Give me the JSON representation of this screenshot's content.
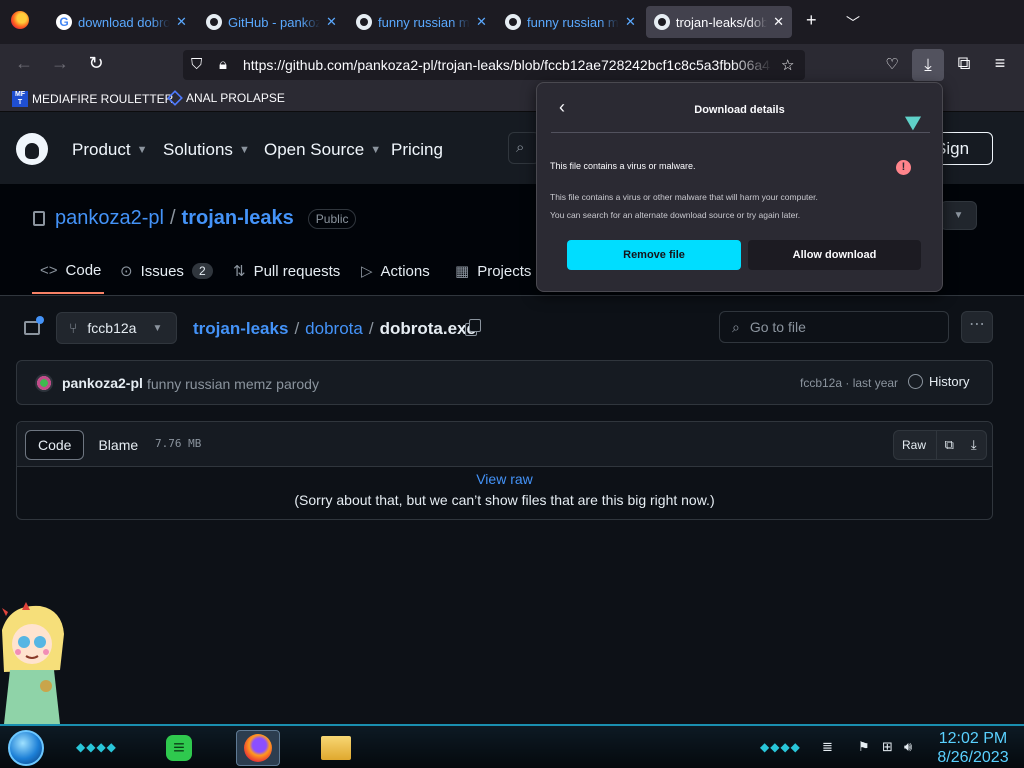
{
  "browser": {
    "tabs": [
      {
        "label": "download dobrota",
        "icon": "google-icon"
      },
      {
        "label": "GitHub - pankoza",
        "icon": "github-icon"
      },
      {
        "label": "funny russian memz",
        "icon": "github-icon"
      },
      {
        "label": "funny russian memz",
        "icon": "github-icon"
      },
      {
        "label": "trojan-leaks/dobrota",
        "icon": "github-icon",
        "active": true
      }
    ],
    "new_tab_symbol": "+",
    "url": "https://github.com/pankoza2-pl/trojan-leaks/blob/fccb12ae728242bcf1c8c5a3fbb06a4",
    "bookmarks": [
      {
        "label": "MEDIAFIRE ROULETTER",
        "icon_text": "MF T"
      },
      {
        "label": "ANAL PROLAPSE",
        "icon": "triangle-icon"
      }
    ]
  },
  "github": {
    "nav": [
      "Product",
      "Solutions",
      "Open Source",
      "Pricing"
    ],
    "sign_up": "Sign up",
    "repo": {
      "owner": "pankoza2-pl",
      "name": "trojan-leaks",
      "visibility": "Public",
      "tabs": [
        {
          "label": "Code"
        },
        {
          "label": "Issues",
          "count": "2"
        },
        {
          "label": "Pull requests"
        },
        {
          "label": "Actions"
        },
        {
          "label": "Projects"
        }
      ]
    },
    "file": {
      "branch": "fccb12a",
      "crumbs": [
        "trojan-leaks",
        "dobrota",
        "dobrota.exe"
      ],
      "goto_placeholder": "Go to file",
      "commit": {
        "author": "pankoza2-pl",
        "message": "funny russian memz parody",
        "meta": "fccb12a · last year",
        "history": "History"
      },
      "view_tabs": [
        "Code",
        "Blame"
      ],
      "size": "7.76 MB",
      "raw_label": "Raw",
      "view_raw": "View raw",
      "too_big": "(Sorry about that, but we can’t show files that are this big right now.)"
    }
  },
  "download_panel": {
    "title": "Download details",
    "warning": "This file contains a virus or malware.",
    "description_1": "This file contains a virus or other malware that will harm your computer.",
    "description_2": "You can search for an alternate download source or try again later.",
    "remove_label": "Remove file",
    "allow_label": "Allow download",
    "accent": "#00ddff",
    "warning_color": "#ff848b"
  },
  "taskbar": {
    "time": "12:02 PM",
    "date": "8/26/2023",
    "apps": [
      "notes-app-icon",
      "firefox-icon",
      "file-explorer-icon"
    ]
  }
}
